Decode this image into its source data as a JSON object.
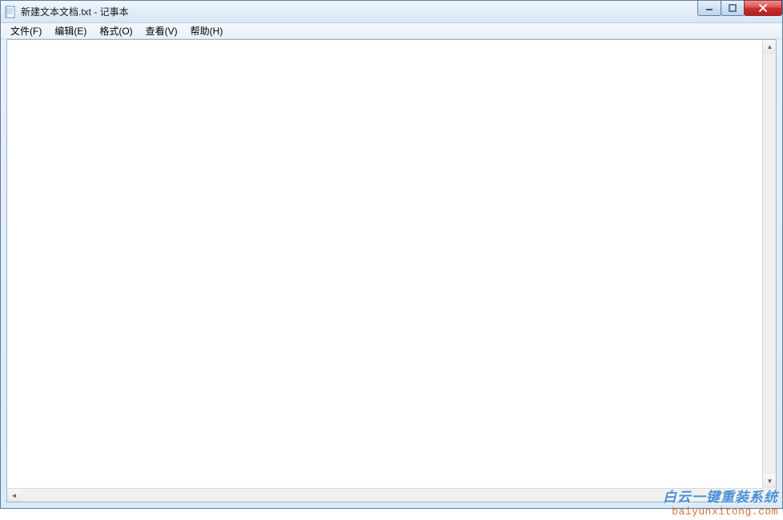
{
  "window": {
    "title": "新建文本文档.txt - 记事本"
  },
  "menubar": {
    "items": [
      {
        "label": "文件(F)"
      },
      {
        "label": "编辑(E)"
      },
      {
        "label": "格式(O)"
      },
      {
        "label": "查看(V)"
      },
      {
        "label": "帮助(H)"
      }
    ]
  },
  "editor": {
    "content": ""
  },
  "watermark": {
    "line1": "白云一键重装系统",
    "line2": "baiyunxitong.com"
  }
}
